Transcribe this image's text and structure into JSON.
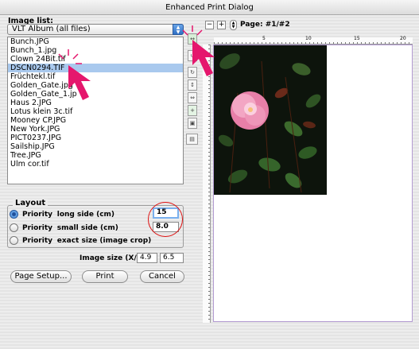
{
  "window": {
    "title": "Enhanced Print Dialog"
  },
  "image_list": {
    "label": "Image list:",
    "album": "VLT Album (all files)",
    "files": [
      "Bunch.JPG",
      "Bunch_1.jpg",
      "Clown 24Bit.tif",
      "DSCN0294.TIF",
      "Früchtekl.tif",
      "Golden_Gate.jpg",
      "Golden_Gate_1.jp",
      "Haus 2.JPG",
      "Lotus klein 3c.tif",
      "Mooney CP.JPG",
      "New York.JPG",
      "PICT0237.JPG",
      "Sailship.JPG",
      "Tree.JPG",
      "Ulm cor.tif"
    ],
    "selected_index": 3
  },
  "layout": {
    "title": "Layout",
    "options": [
      {
        "priority": "Priority",
        "desc": "long side (cm)",
        "selected": true
      },
      {
        "priority": "Priority",
        "desc": "small side (cm)",
        "selected": false
      },
      {
        "priority": "Priority",
        "desc": "exact size (image crop)",
        "selected": false
      }
    ],
    "long_side_value": "15",
    "small_side_value": "8.0",
    "image_size_label": "Image size (X/Y):",
    "image_size_x": "4.9",
    "image_size_y": "6.5"
  },
  "buttons": {
    "page_setup": "Page Setup...",
    "print": "Print",
    "cancel": "Cancel"
  },
  "preview": {
    "zoom_out": "−",
    "zoom_in": "+",
    "page_label": "Page: #1/#2",
    "ruler_marks": [
      "5",
      "10",
      "15",
      "20"
    ]
  },
  "colors": {
    "selection": "#a9c9ee",
    "highlight_ring": "#dd1111",
    "pointer_arrow": "#e5176d",
    "page_border": "#b39bd2"
  }
}
